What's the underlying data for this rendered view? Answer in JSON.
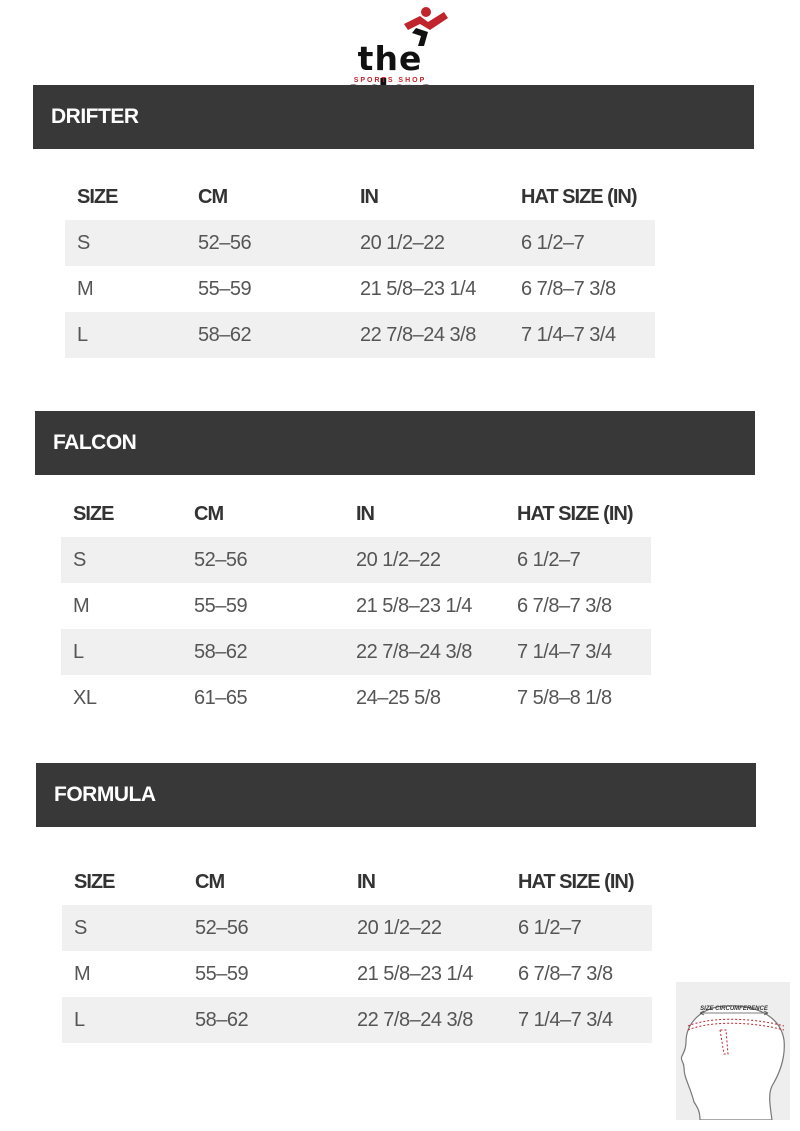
{
  "brand": {
    "name": "the edge",
    "tagline": "SPORTS SHOP",
    "colors": {
      "mark_red": "#c0242c",
      "mark_black": "#111111"
    }
  },
  "columns": [
    "SIZE",
    "CM",
    "IN",
    "HAT SIZE (IN)"
  ],
  "sections": [
    {
      "title": "DRIFTER",
      "rows": [
        [
          "S",
          "52–56",
          "20 1/2–22",
          "6 1/2–7"
        ],
        [
          "M",
          "55–59",
          "21 5/8–23 1/4",
          "6 7/8–7 3/8"
        ],
        [
          "L",
          "58–62",
          "22 7/8–24 3/8",
          "7 1/4–7 3/4"
        ]
      ]
    },
    {
      "title": "FALCON",
      "rows": [
        [
          "S",
          "52–56",
          "20 1/2–22",
          "6 1/2–7"
        ],
        [
          "M",
          "55–59",
          "21 5/8–23 1/4",
          "6 7/8–7 3/8"
        ],
        [
          "L",
          "58–62",
          "22 7/8–24 3/8",
          "7 1/4–7 3/4"
        ],
        [
          "XL",
          "61–65",
          "24–25 5/8",
          "7 5/8–8 1/8"
        ]
      ]
    },
    {
      "title": "FORMULA",
      "rows": [
        [
          "S",
          "52–56",
          "20 1/2–22",
          "6 1/2–7"
        ],
        [
          "M",
          "55–59",
          "21 5/8–23 1/4",
          "6 7/8–7 3/8"
        ],
        [
          "L",
          "58–62",
          "22 7/8–24 3/8",
          "7 1/4–7 3/4"
        ]
      ]
    }
  ],
  "diagram": {
    "label": "SIZE CIRCUMFERENCE",
    "icon": "head-measurement-icon"
  }
}
